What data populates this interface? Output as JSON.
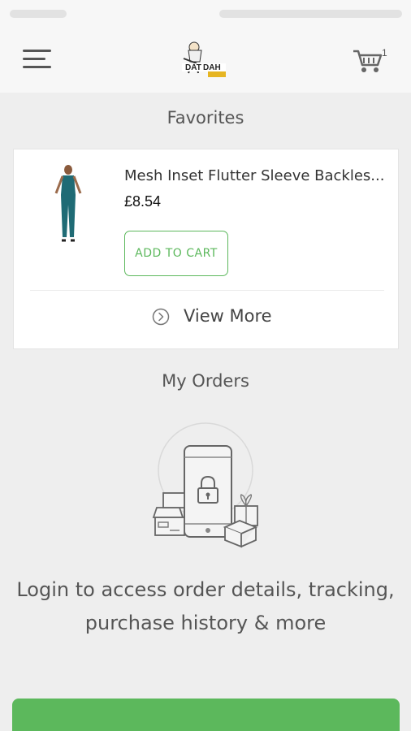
{
  "app": {
    "cart_count": "1"
  },
  "favorites": {
    "title": "Favorites",
    "product": {
      "name": "Mesh Inset Flutter Sleeve Backles...",
      "price": "£8.54"
    },
    "add_to_cart_label": "ADD TO CART",
    "view_more_label": "View More"
  },
  "orders": {
    "title": "My Orders",
    "login_message_line1": "Login to access order details, tracking,",
    "login_message_line2": "purchase history & more"
  },
  "icons": {
    "menu": "hamburger-menu-icon",
    "cart": "shopping-cart-icon",
    "view_more": "chevron-right-circle-icon",
    "illustration": "locked-phone-with-packages-illustration"
  },
  "colors": {
    "accent": "#5cb85c",
    "background": "#eeeeee",
    "card": "#ffffff",
    "appbar": "#f7f7f7"
  }
}
